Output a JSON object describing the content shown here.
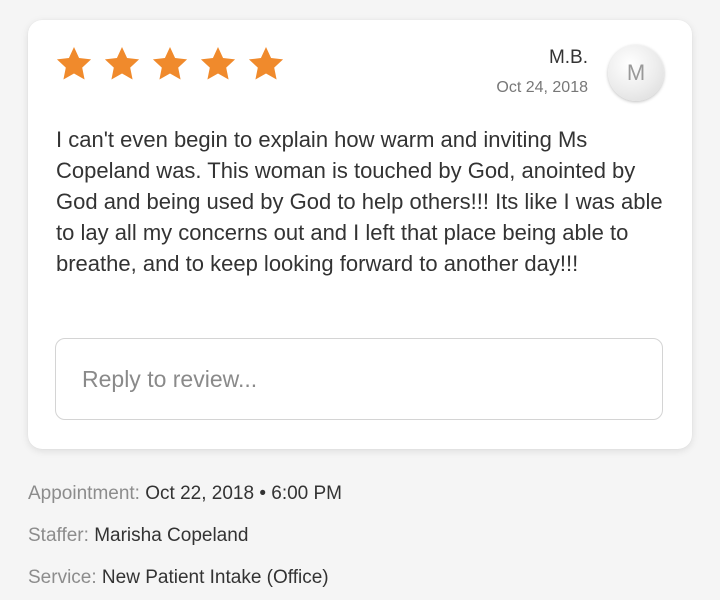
{
  "review": {
    "rating": 5,
    "max_rating": 5,
    "star_color": "#f08a2c",
    "reviewer_name": "M.B.",
    "date": "Oct 24, 2018",
    "avatar_initial": "M",
    "text": "I can't even begin to explain how warm and inviting Ms Copeland was. This woman is touched by God, anointed by God and being used by God to help others!!! Its like I was able to lay all my concerns out and I left that place being able to breathe, and to keep looking forward to another day!!!",
    "reply_placeholder": "Reply to review...",
    "reply_value": ""
  },
  "details": {
    "appointment_label": "Appointment:",
    "appointment_value": "Oct 22, 2018 • 6:00 PM",
    "staffer_label": "Staffer:",
    "staffer_value": "Marisha Copeland",
    "service_label": "Service:",
    "service_value": "New Patient Intake (Office)"
  }
}
